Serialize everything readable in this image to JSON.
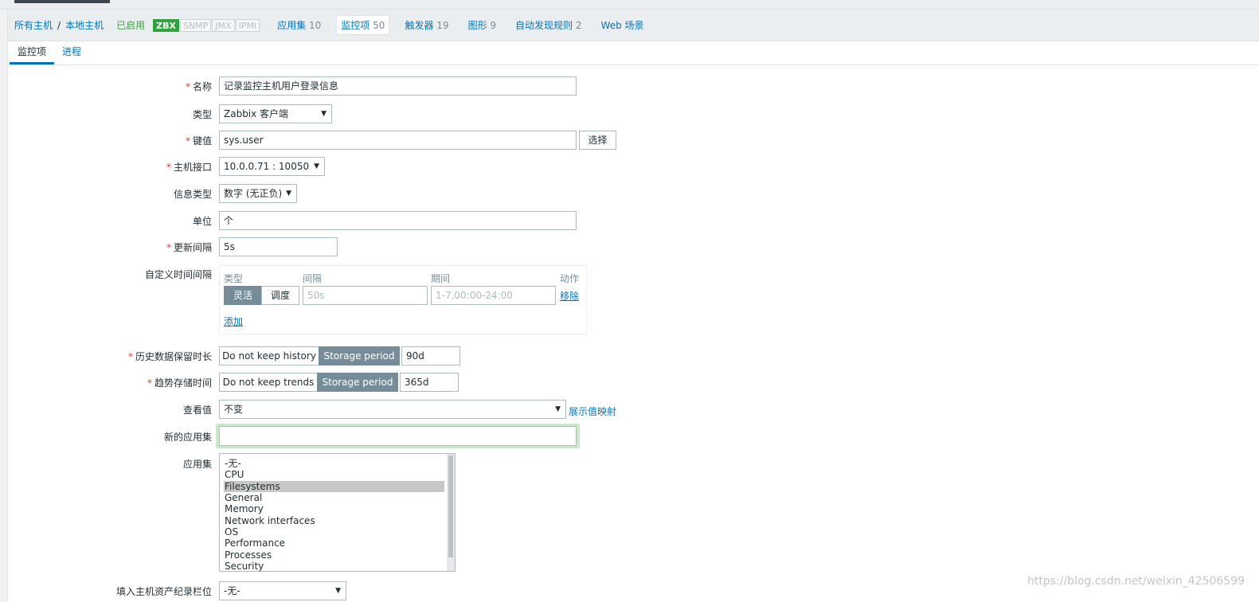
{
  "host_nav": {
    "crumb_all_hosts": "所有主机",
    "crumb_sep": "/",
    "crumb_host": "本地主机",
    "status": "已启用",
    "availability": [
      "ZBX",
      "SNMP",
      "JMX",
      "IPMI"
    ],
    "links": [
      {
        "label": "应用集",
        "count": "10"
      },
      {
        "label": "监控项",
        "count": "50"
      },
      {
        "label": "触发器",
        "count": "19"
      },
      {
        "label": "图形",
        "count": "9"
      },
      {
        "label": "自动发现规则",
        "count": "2"
      },
      {
        "label": "Web 场景",
        "count": ""
      }
    ]
  },
  "tabs": [
    "监控项",
    "进程"
  ],
  "form": {
    "name": {
      "label": "名称",
      "value": "记录监控主机用户登录信息"
    },
    "type": {
      "label": "类型",
      "value": "Zabbix 客户端"
    },
    "key": {
      "label": "键值",
      "value": "sys.user",
      "button": "选择"
    },
    "interface": {
      "label": "主机接口",
      "value": "10.0.0.71 : 10050"
    },
    "info_type": {
      "label": "信息类型",
      "value": "数字 (无正负)"
    },
    "units": {
      "label": "单位",
      "value": "个"
    },
    "update_interval": {
      "label": "更新间隔",
      "value": "5s"
    },
    "custom_intervals": {
      "label": "自定义时间间隔",
      "headers": [
        "类型",
        "间隔",
        "期间",
        "动作"
      ],
      "type_options": [
        "灵活",
        "调度"
      ],
      "interval_placeholder": "50s",
      "period_placeholder": "1-7,00:00-24:00",
      "remove": "移除",
      "add": "添加"
    },
    "history": {
      "label": "历史数据保留时长",
      "opt_no": "Do not keep history",
      "opt_storage": "Storage period",
      "value": "90d"
    },
    "trends": {
      "label": "趋势存储时间",
      "opt_no": "Do not keep trends",
      "opt_storage": "Storage period",
      "value": "365d"
    },
    "show_value": {
      "label": "查看值",
      "value": "不变",
      "link": "展示值映射"
    },
    "new_application": {
      "label": "新的应用集",
      "value": ""
    },
    "applications": {
      "label": "应用集",
      "options": [
        "-无-",
        "CPU",
        "Filesystems",
        "General",
        "Memory",
        "Network interfaces",
        "OS",
        "Performance",
        "Processes",
        "Security"
      ],
      "selected": "Filesystems"
    },
    "inventory": {
      "label": "填入主机资产纪录栏位",
      "value": "-无-"
    }
  },
  "watermark": "https://blog.csdn.net/weixin_42506599"
}
